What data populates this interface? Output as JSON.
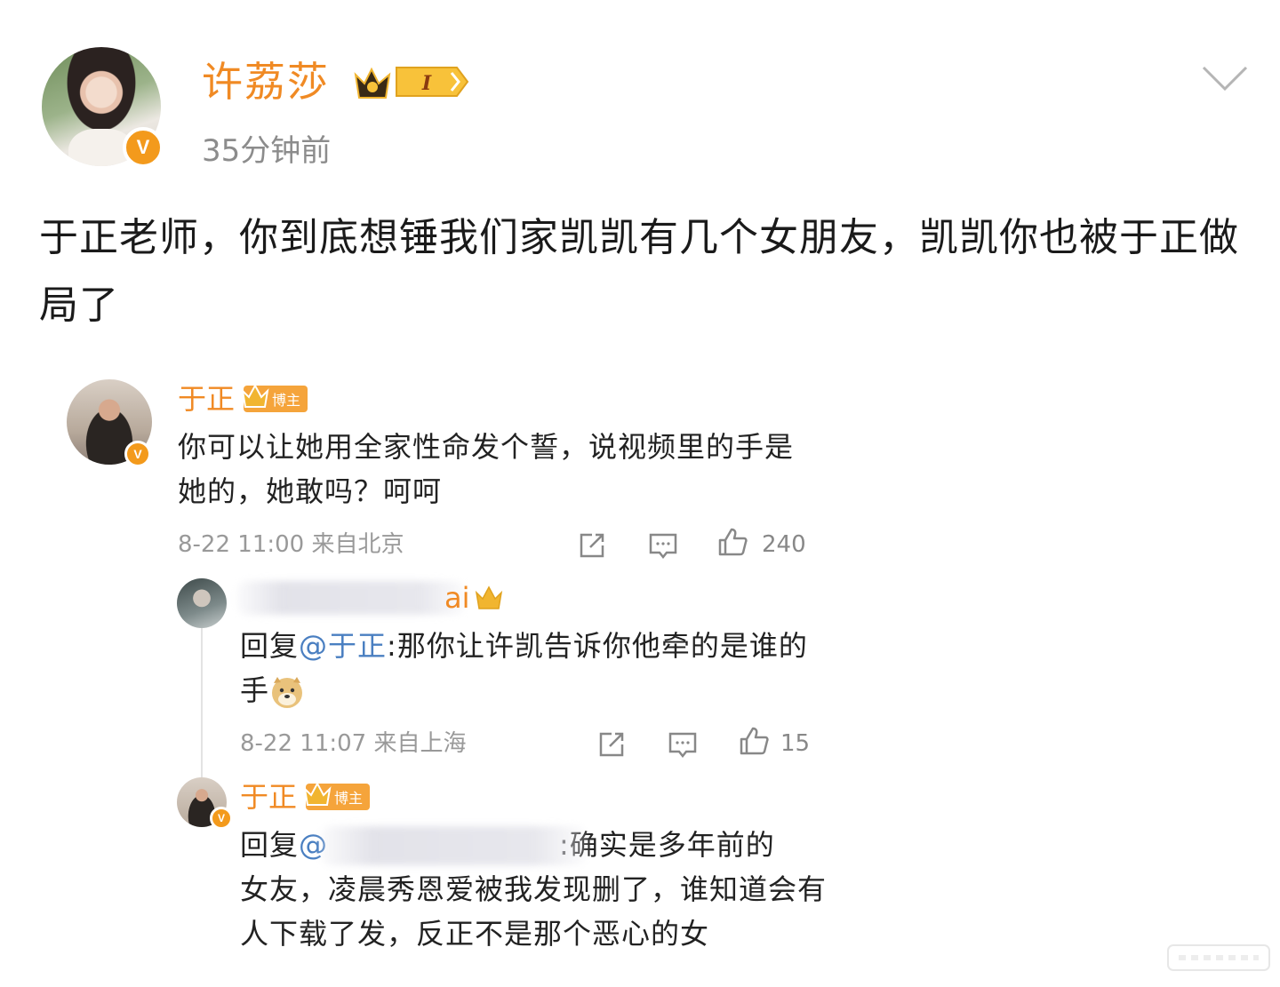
{
  "post": {
    "author": "许荔莎",
    "level_badge": "I",
    "time": "35分钟前",
    "text": "于正老师，你到底想锤我们家凯凯有几个女朋友，凯凯你也被于正做局了"
  },
  "comments": {
    "main": {
      "author": "于正",
      "tag": "博主",
      "text": "你可以让她用全家性命发个誓，说视频里的手是她的，她敢吗？呵呵",
      "meta": "8-22 11:00 来自北京",
      "likes": "240"
    },
    "reply1": {
      "author_visible": "ai",
      "text_prefix": "回复",
      "mention": "@于正",
      "text": ":那你让许凯告诉你他牵的是谁的手",
      "meta": "8-22 11:07 来自上海",
      "likes": "15"
    },
    "reply2": {
      "author": "于正",
      "tag": "博主",
      "text_prefix": "回复",
      "mention": "@",
      "text_after_blur": ":确实是多年前的",
      "text_rest": "女友，凌晨秀恩爱被我发现删了，谁知道会有人下载了发，反正不是那个恶心的女"
    }
  },
  "colors": {
    "accent_orange": "#f08a24",
    "verified_orange": "#f39a1c",
    "mention_blue": "#4a7fc1",
    "meta_gray": "#999999"
  },
  "icons": [
    "chevron-down-icon",
    "crown-icon",
    "verified-icon",
    "share-icon",
    "comment-icon",
    "like-icon",
    "doge-emoji-icon"
  ]
}
